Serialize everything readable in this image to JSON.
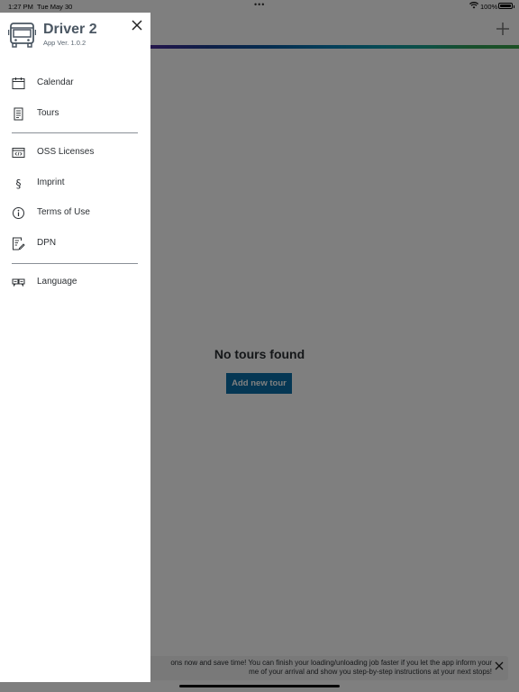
{
  "status_bar": {
    "time": "1:27 PM",
    "date": "Tue May 30",
    "battery": "100%"
  },
  "main": {
    "empty_title": "No tours found",
    "add_tour_label": "Add new tour"
  },
  "notification": {
    "line1": "ons now and save time! You can finish your loading/unloading job faster if you let the app inform your",
    "line2": "me of your arrival and show you step-by-step instructions at your next stops!"
  },
  "drawer": {
    "title": "Driver 2",
    "version": "App Ver. 1.0.2",
    "menu": [
      {
        "label": "Calendar",
        "icon": "calendar-icon"
      },
      {
        "label": "Tours",
        "icon": "document-list-icon"
      },
      {
        "label": "OSS Licenses",
        "icon": "code-window-icon"
      },
      {
        "label": "Imprint",
        "icon": "section-sign-icon"
      },
      {
        "label": "Terms of Use",
        "icon": "info-circle-icon"
      },
      {
        "label": "DPN",
        "icon": "document-edit-icon"
      },
      {
        "label": "Language",
        "icon": "translate-icon"
      }
    ]
  },
  "colors": {
    "primary_button": "#0a6fa8",
    "scrim": "rgba(0,0,0,0.5)",
    "drawer_title": "#4b5763"
  }
}
